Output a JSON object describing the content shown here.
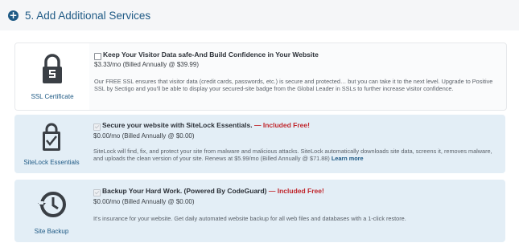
{
  "section": {
    "title": "5. Add Additional Services",
    "accent_color": "#1f5a85"
  },
  "services": [
    {
      "name": "SSL Certificate",
      "icon": "padlock-ssl-icon",
      "title": "Keep Your Visitor Data safe-And Build Confidence in Your Website",
      "included_label": "",
      "price": "$3.33/mo (Billed Annually @ $39.99)",
      "description": "Our FREE SSL ensures that visitor data (credit cards, passwords, etc.) is secure and protected… but you can take it to the next level. Upgrade to Positive SSL by Sectigo and you'll be able to display your secured-site badge from the Global Leader in SSLs to further increase visitor confidence.",
      "link": "",
      "checked": false,
      "disabled": false
    },
    {
      "name": "SiteLock Essentials",
      "icon": "sitelock-check-icon",
      "title": "Secure your website with SiteLock Essentials.",
      "included_label": "— Included Free!",
      "price": "$0.00/mo (Billed Annually @ $0.00)",
      "description": "SiteLock will find, fix, and protect your site from malware and malicious attacks. SiteLock automatically downloads site data, screens it, removes malware, and uploads the clean version of your site. Renews at $5.99/mo (Billed Annually @ $71.88) ",
      "link": "Learn more",
      "checked": true,
      "disabled": true
    },
    {
      "name": "Site Backup",
      "icon": "backup-history-icon",
      "title": "Backup Your Hard Work. (Powered By CodeGuard)",
      "included_label": "— Included Free!",
      "price": "$0.00/mo (Billed Annually @ $0.00)",
      "description": "It's insurance for your website. Get daily automated website backup for all web files and databases with a 1-click restore.",
      "link": "",
      "checked": true,
      "disabled": true
    }
  ]
}
